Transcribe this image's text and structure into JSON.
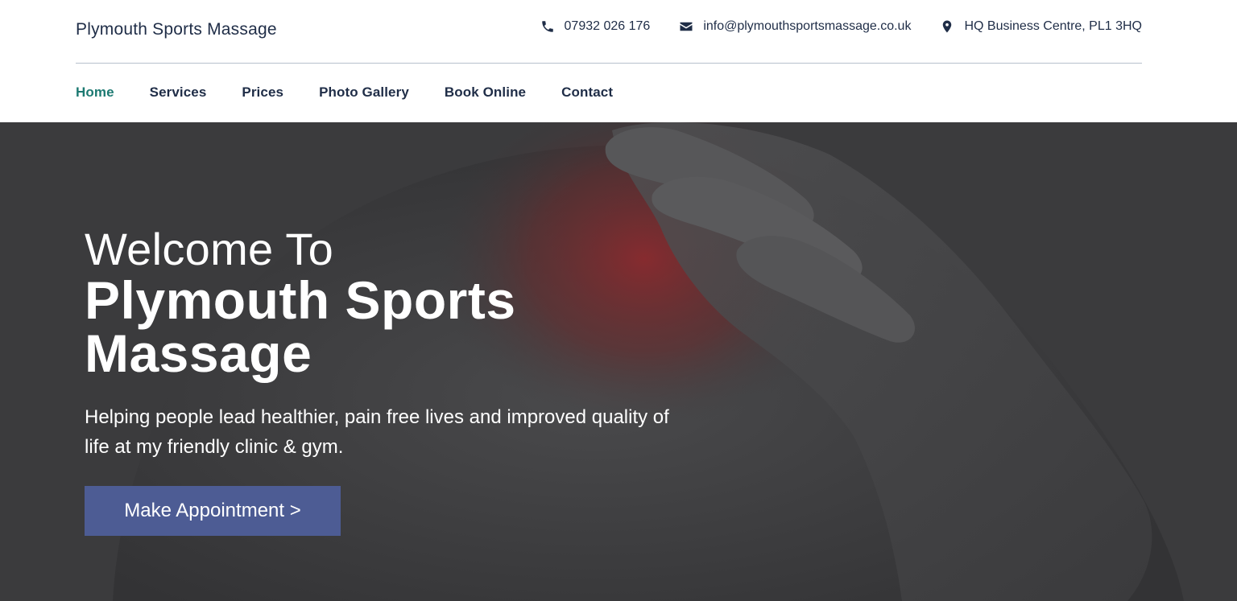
{
  "brand": {
    "name": "Plymouth Sports Massage"
  },
  "contacts": [
    {
      "icon": "phone-icon",
      "text": "07932 026 176"
    },
    {
      "icon": "envelope-icon",
      "text": "info@plymouthsportsmassage.co.uk"
    },
    {
      "icon": "map-pin-icon",
      "text": "HQ Business Centre, PL1 3HQ"
    }
  ],
  "nav": {
    "items": [
      {
        "label": "Home",
        "active": true
      },
      {
        "label": "Services"
      },
      {
        "label": "Prices"
      },
      {
        "label": "Photo Gallery"
      },
      {
        "label": "Book Online"
      },
      {
        "label": "Contact"
      }
    ]
  },
  "hero": {
    "welcome": "Welcome To",
    "title": "Plymouth Sports Massage",
    "tagline": "Helping people lead healthier, pain free lives and improved quality of life at my friendly clinic & gym.",
    "cta_label": "Make Appointment >"
  },
  "colors": {
    "text_dark": "#1f2d47",
    "nav_active": "#1d7a72",
    "cta_background": "#4d5c94",
    "hero_overlay": "#3a3a3c",
    "pain_highlight": "#8a2a2e"
  }
}
